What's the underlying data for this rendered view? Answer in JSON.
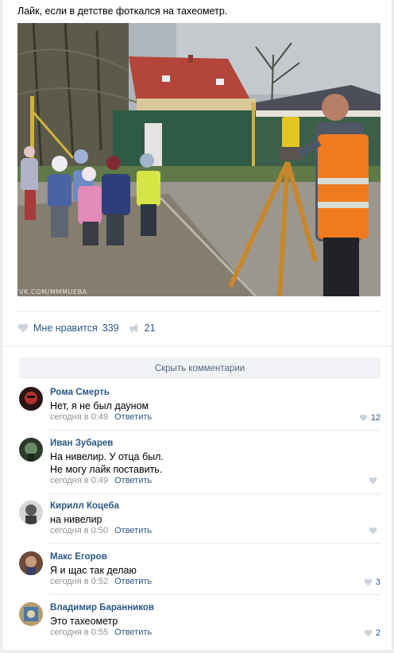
{
  "post": {
    "text": "Лайк, если в детстве фоткался на тахеометр.",
    "watermark": "VK.COM/MMMUEBA"
  },
  "actions": {
    "like_label": "Мне нравится",
    "like_count": "339",
    "share_count": "21"
  },
  "hide_comments_label": "Скрыть комментарии",
  "reply_label": "Ответить",
  "comments": [
    {
      "name": "Рома Смерть",
      "text": "Нет, я не был дауном",
      "time": "сегодня в 0:49",
      "likes": "12"
    },
    {
      "name": "Иван Зубарев",
      "text": "На нивелир. У отца был.\nНе могу лайк поставить.",
      "time": "сегодня в 0:49",
      "likes": ""
    },
    {
      "name": "Кирилл Коцеба",
      "text": "на нивелир",
      "time": "сегодня в 0:50",
      "likes": ""
    },
    {
      "name": "Макс Егоров",
      "text": "Я и щас так делаю",
      "time": "сегодня в 0:52",
      "likes": "3"
    },
    {
      "name": "Владимир Баранников",
      "text": "Это тахеометр",
      "time": "сегодня в 0:55",
      "likes": "2"
    }
  ],
  "colors": {
    "link": "#2a5885",
    "meta": "#939393",
    "vest": "#f07a1e"
  }
}
